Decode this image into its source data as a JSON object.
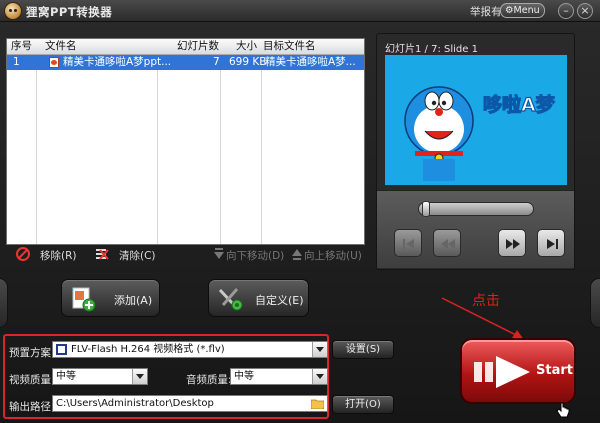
{
  "window": {
    "title": "狸窝PPT转换器",
    "report_label": "举报有奖",
    "menu_label": "Menu",
    "minimize_label": "–",
    "close_label": "×"
  },
  "file_list": {
    "columns": [
      "序号",
      "文件名",
      "幻灯片数",
      "大小",
      "目标文件名"
    ],
    "rows": [
      {
        "index": "1",
        "filename": "精美卡通哆啦A梦ppt...",
        "slides": "7",
        "size": "699 KB",
        "target": "精美卡通哆啦A梦..."
      }
    ]
  },
  "list_toolbar": {
    "remove": "移除(R)",
    "clear": "清除(C)",
    "move_down": "向下移动(D)",
    "move_up": "向上移动(U)"
  },
  "preview": {
    "label": "幻灯片1 / 7: Slide 1",
    "slide_text": "哆啦A梦",
    "progress": 0.0
  },
  "actions": {
    "add": "添加(A)",
    "customize": "自定义(E)"
  },
  "settings": {
    "preset_label": "预置方案:",
    "preset_value": "FLV-Flash H.264 视频格式 (*.flv)",
    "settings_btn": "设置(S)",
    "video_quality_label": "视频质量:",
    "video_quality_value": "中等",
    "audio_quality_label": "音频质量:",
    "audio_quality_value": "中等",
    "output_label": "输出路径:",
    "output_value": "C:\\Users\\Administrator\\Desktop",
    "open_btn": "打开(O)"
  },
  "annotation": {
    "text": "点击"
  },
  "start_label": "Start",
  "colors": {
    "accent_red": "#d9242a",
    "selection_blue": "#2f74d6",
    "slide_bg": "#1aa9e6"
  }
}
